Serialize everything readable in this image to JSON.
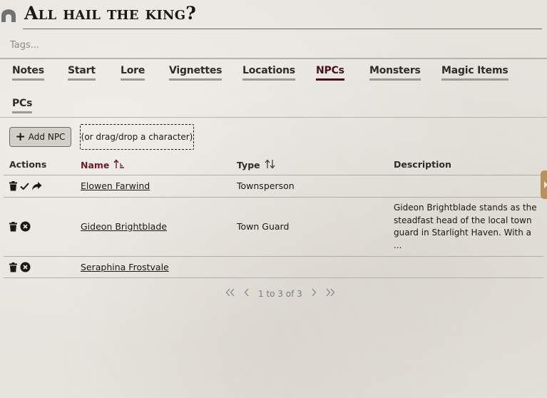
{
  "header": {
    "title": "All hail the king?",
    "tags_placeholder": "Tags..."
  },
  "tabs": [
    {
      "label": "Notes",
      "active": false
    },
    {
      "label": "Start",
      "active": false
    },
    {
      "label": "Lore",
      "active": false
    },
    {
      "label": "Vignettes",
      "active": false
    },
    {
      "label": "Locations",
      "active": false
    },
    {
      "label": "NPCs",
      "active": true
    },
    {
      "label": "Monsters",
      "active": false
    },
    {
      "label": "Magic Items",
      "active": false
    },
    {
      "label": "PCs",
      "active": false
    }
  ],
  "toolbar": {
    "add_label": "Add NPC",
    "drop_label": "(or drag/drop a character)"
  },
  "table": {
    "columns": [
      "Actions",
      "Name",
      "Type",
      "Description"
    ],
    "sorted_column": "Name",
    "rows": [
      {
        "name": "Elowen Farwind",
        "type": "Townsperson",
        "description": "",
        "actions": [
          "trash-icon",
          "check-icon",
          "share-icon"
        ]
      },
      {
        "name": "Gideon Brightblade",
        "type": "Town Guard",
        "description": "Gideon Brightblade stands as the steadfast head of the local town guard in Starlight Haven. With a ...",
        "actions": [
          "trash-icon",
          "remove-icon"
        ]
      },
      {
        "name": "Seraphina Frostvale",
        "type": "",
        "description": "",
        "actions": [
          "trash-icon",
          "remove-icon"
        ]
      }
    ]
  },
  "pagination": {
    "text": "1 to 3 of 3"
  },
  "colors": {
    "accent": "#4b1014",
    "sorted_header": "#6e1c24",
    "side_handle": "#b9915e"
  }
}
